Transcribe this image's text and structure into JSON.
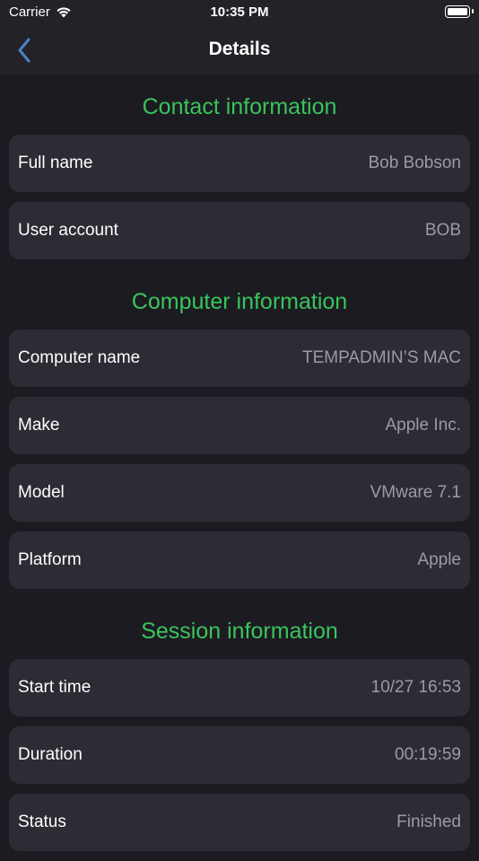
{
  "status_bar": {
    "carrier": "Carrier",
    "time": "10:35 PM"
  },
  "nav": {
    "title": "Details",
    "back_icon": "chevron-left-icon"
  },
  "colors": {
    "section_header": "#39c55a",
    "background": "#1c1b22",
    "row_background": "#2d2b33",
    "value_text": "#9c9ba2",
    "back_icon": "#4a82c7"
  },
  "sections": [
    {
      "title": "Contact information",
      "rows": [
        {
          "label": "Full name",
          "value": "Bob Bobson"
        },
        {
          "label": "User account",
          "value": "BOB"
        }
      ]
    },
    {
      "title": "Computer information",
      "rows": [
        {
          "label": "Computer name",
          "value": "TEMPADMIN’S MAC"
        },
        {
          "label": "Make",
          "value": "Apple Inc."
        },
        {
          "label": "Model",
          "value": "VMware 7.1"
        },
        {
          "label": "Platform",
          "value": "Apple"
        }
      ]
    },
    {
      "title": "Session information",
      "rows": [
        {
          "label": "Start time",
          "value": "10/27 16:53"
        },
        {
          "label": "Duration",
          "value": "00:19:59"
        },
        {
          "label": "Status",
          "value": "Finished"
        }
      ]
    }
  ]
}
